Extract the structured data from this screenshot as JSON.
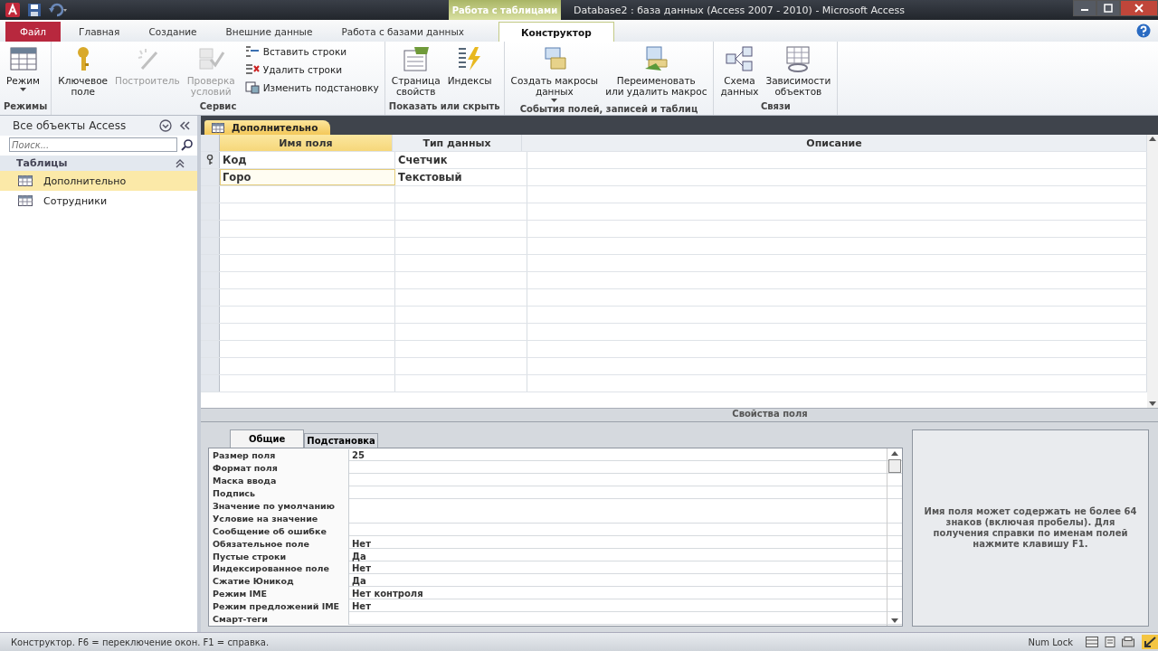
{
  "window": {
    "title": "Database2 : база данных (Access 2007 - 2010) - Microsoft Access",
    "context_tab": "Работа с таблицами"
  },
  "ribbon_tabs": [
    {
      "label": "Файл",
      "kind": "file",
      "selected": false
    },
    {
      "label": "Главная",
      "kind": "tab",
      "selected": false
    },
    {
      "label": "Создание",
      "kind": "tab",
      "selected": false
    },
    {
      "label": "Внешние данные",
      "kind": "tab",
      "selected": false
    },
    {
      "label": "Работа с базами данных",
      "kind": "tab",
      "selected": false
    },
    {
      "label": "Конструктор",
      "kind": "context",
      "selected": true
    }
  ],
  "ribbon_groups": [
    {
      "label": "Режимы",
      "buttons": [
        {
          "label": "Режим",
          "kind": "large",
          "disabled": false,
          "dropdown": true
        }
      ]
    },
    {
      "label": "Сервис",
      "buttons": [
        {
          "label": "Ключевое\nполе",
          "kind": "large",
          "disabled": false,
          "dropdown": false
        },
        {
          "label": "Построитель",
          "kind": "large",
          "disabled": true,
          "dropdown": false
        },
        {
          "label": "Проверка\nусловий",
          "kind": "large",
          "disabled": true,
          "dropdown": false
        },
        {
          "label": "Вставить строки",
          "kind": "small",
          "disabled": false,
          "dropdown": false
        },
        {
          "label": "Удалить строки",
          "kind": "small",
          "disabled": false,
          "dropdown": false
        },
        {
          "label": "Изменить подстановку",
          "kind": "small",
          "disabled": false,
          "dropdown": false
        }
      ]
    },
    {
      "label": "Показать или скрыть",
      "buttons": [
        {
          "label": "Страница\nсвойств",
          "kind": "large",
          "disabled": false,
          "dropdown": false
        },
        {
          "label": "Индексы",
          "kind": "large",
          "disabled": false,
          "dropdown": false
        }
      ]
    },
    {
      "label": "События полей, записей и таблиц",
      "buttons": [
        {
          "label": "Создать макросы\nданных",
          "kind": "large",
          "disabled": false,
          "dropdown": true
        },
        {
          "label": "Переименовать\nили удалить макрос",
          "kind": "large",
          "disabled": false,
          "dropdown": false
        }
      ]
    },
    {
      "label": "Связи",
      "buttons": [
        {
          "label": "Схема\nданных",
          "kind": "large",
          "disabled": false,
          "dropdown": false
        },
        {
          "label": "Зависимости\nобъектов",
          "kind": "large",
          "disabled": false,
          "dropdown": false
        }
      ]
    }
  ],
  "nav": {
    "title": "Все объекты Access",
    "search": {
      "placeholder": "Поиск..."
    },
    "group": "Таблицы",
    "items": [
      {
        "label": "Дополнительно",
        "selected": true
      },
      {
        "label": "Сотрудники",
        "selected": false
      }
    ]
  },
  "document_tab": "Дополнительно",
  "design_grid": {
    "columns": [
      "Имя поля",
      "Тип данных",
      "Описание"
    ],
    "rows": [
      {
        "name": "Код",
        "type": "Счетчик",
        "primary_key": true,
        "editing": false
      },
      {
        "name": "Горо",
        "type": "Текстовый",
        "primary_key": false,
        "editing": true
      }
    ]
  },
  "field_properties": {
    "title": "Свойства поля",
    "tabs": [
      {
        "label": "Общие",
        "selected": true
      },
      {
        "label": "Подстановка",
        "selected": false
      }
    ],
    "rows": [
      {
        "label": "Размер поля",
        "value": "25"
      },
      {
        "label": "Формат поля"
      },
      {
        "label": "Маска ввода"
      },
      {
        "label": "Подпись"
      },
      {
        "label": "Значение по умолчанию"
      },
      {
        "label": "Условие на значение"
      },
      {
        "label": "Сообщение об ошибке"
      },
      {
        "label": "Обязательное поле",
        "value": "Нет"
      },
      {
        "label": "Пустые строки",
        "value": "Да"
      },
      {
        "label": "Индексированное поле",
        "value": "Нет"
      },
      {
        "label": "Сжатие Юникод",
        "value": "Да"
      },
      {
        "label": "Режим IME",
        "value": "Нет контроля"
      },
      {
        "label": "Режим предложений IME",
        "value": "Нет"
      },
      {
        "label": "Смарт-теги"
      }
    ],
    "help": "Имя поля может содержать не более 64 знаков (включая пробелы). Для получения справки по именам полей нажмите клавишу F1."
  },
  "status_bar": {
    "text": "Конструктор.  F6 = переключение окон.  F1 = справка.",
    "indicator": "Num Lock"
  }
}
